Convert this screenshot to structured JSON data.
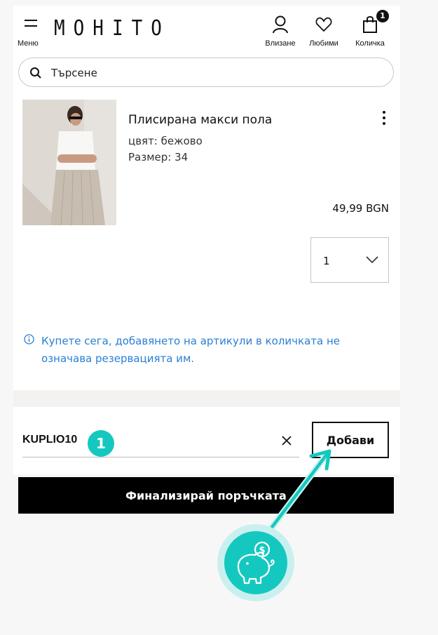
{
  "header": {
    "menu_label": "Меню",
    "logo_text": "MOHITO",
    "login_label": "Влизане",
    "favorites_label": "Любими",
    "cart_label": "Количка",
    "cart_count": "1"
  },
  "search": {
    "placeholder": "Търсене"
  },
  "product": {
    "name": "Плисирана макси пола",
    "color": "цвят: бежово",
    "size": "Размер: 34",
    "price": "49,99 BGN",
    "quantity": "1"
  },
  "notice": {
    "text": "Купете сега, добавянето на артикули в количката не означава резервацията им.",
    "color": "#2a7fd4"
  },
  "coupon": {
    "value": "KUPLIO10",
    "step_number": "1",
    "add_label": "Добави"
  },
  "checkout": {
    "label": "Финализирай поръчката"
  },
  "colors": {
    "accent_teal": "#15c8bf",
    "button_black": "#000000"
  }
}
